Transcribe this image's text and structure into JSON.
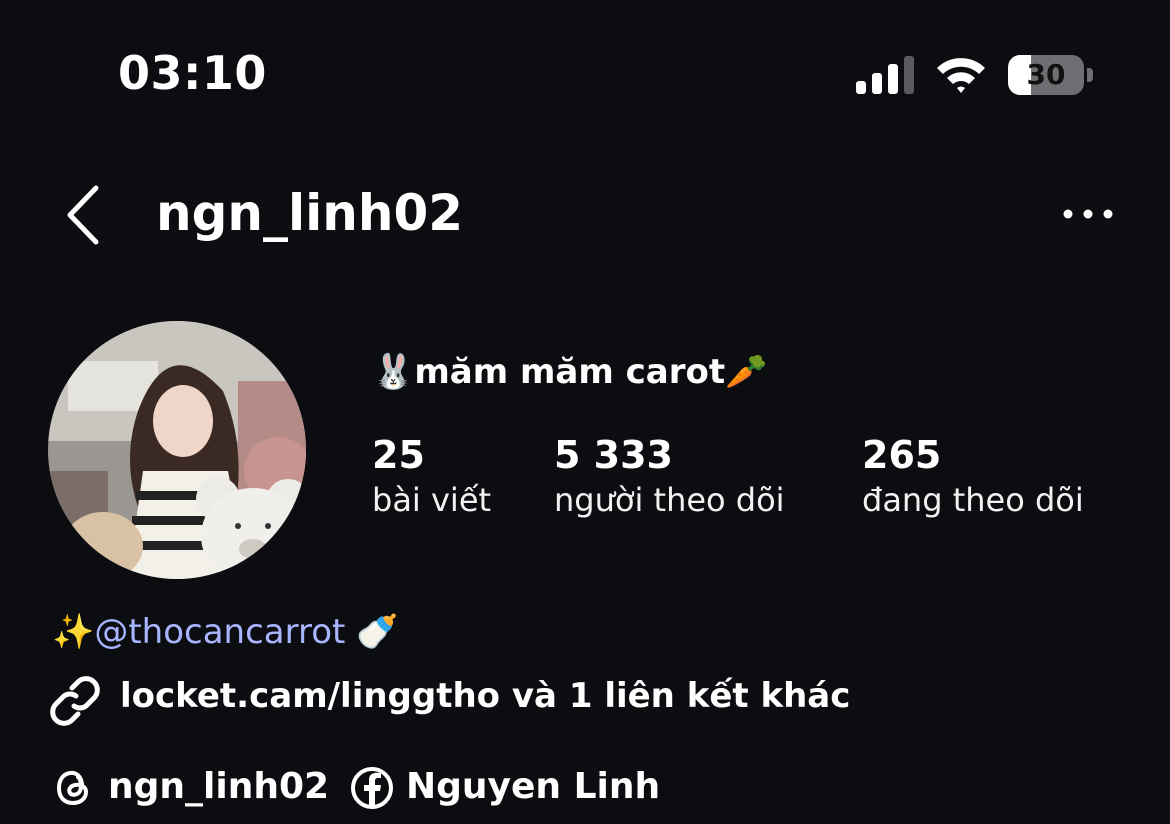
{
  "status_bar": {
    "time": "03:10",
    "battery_percent": "30",
    "battery_level": 0.3
  },
  "header": {
    "username": "ngn_linh02"
  },
  "profile": {
    "display_name": "🐰măm măm carot🥕",
    "stats": [
      {
        "value": "25",
        "label": "bài viết"
      },
      {
        "value": "5 333",
        "label": "người theo dõi"
      },
      {
        "value": "265",
        "label": "đang theo dõi"
      }
    ],
    "bio": {
      "prefix_emoji": "✨",
      "mention": "@thocancarrot",
      "suffix_emoji": "🍼"
    },
    "link_text": "locket.cam/linggtho và 1 liên kết khác",
    "threads": {
      "label": "ngn_linh02",
      "icon": "threads-icon"
    },
    "facebook": {
      "label": "Nguyen Linh",
      "icon": "facebook-icon"
    }
  }
}
